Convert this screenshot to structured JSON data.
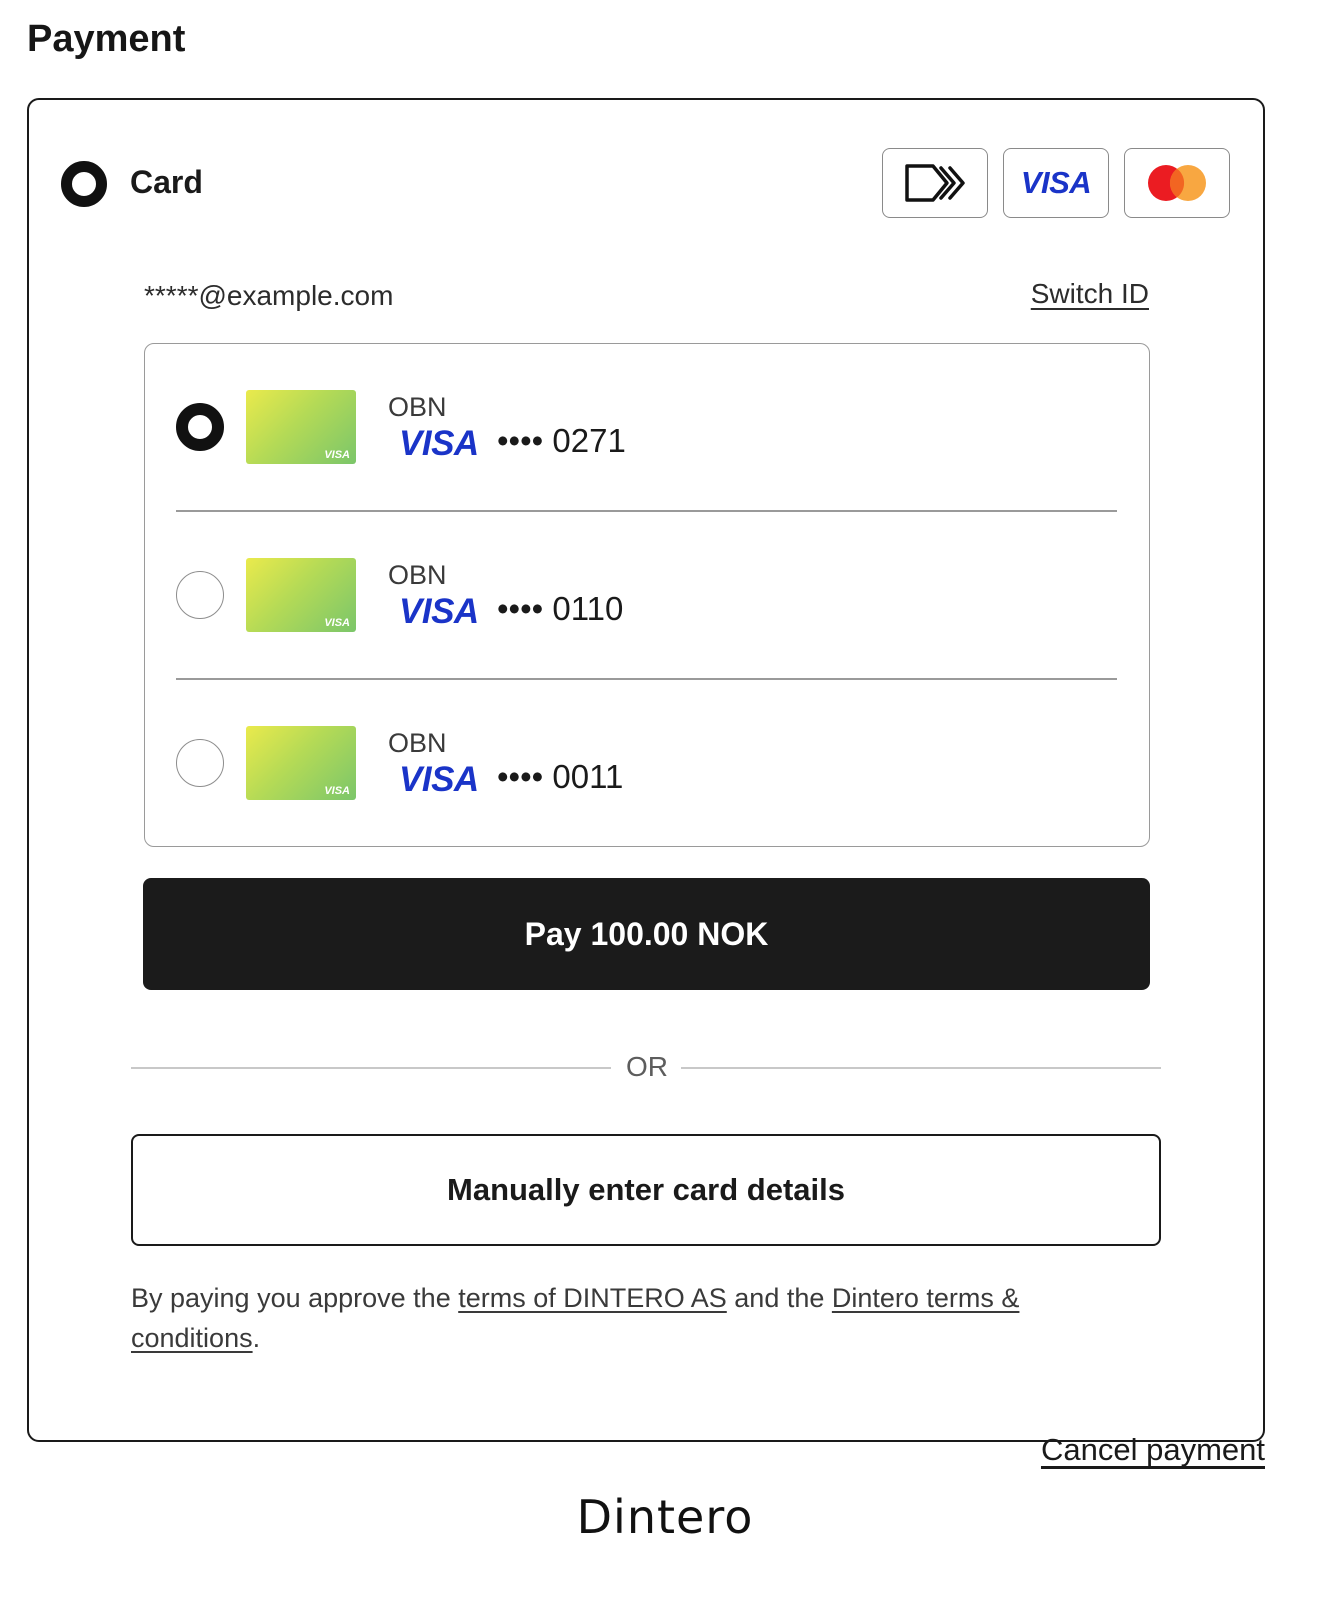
{
  "page": {
    "title": "Payment"
  },
  "method": {
    "label": "Card",
    "brands": [
      {
        "name": "click-to-pay-icon"
      },
      {
        "name": "visa",
        "text": "VISA"
      },
      {
        "name": "mastercard-icon"
      }
    ]
  },
  "identity": {
    "email": "*****@example.com",
    "switch_label": "Switch ID"
  },
  "saved_cards": [
    {
      "issuer": "OBN",
      "brand": "VISA",
      "thumb_brand": "VISA",
      "masked": "•••• 0271",
      "selected": true
    },
    {
      "issuer": "OBN",
      "brand": "VISA",
      "thumb_brand": "VISA",
      "masked": "•••• 0110",
      "selected": false
    },
    {
      "issuer": "OBN",
      "brand": "VISA",
      "thumb_brand": "VISA",
      "masked": "•••• 0011",
      "selected": false
    }
  ],
  "pay_button": {
    "label": "Pay 100.00 NOK"
  },
  "separator": {
    "label": "OR"
  },
  "manual_button": {
    "label": "Manually enter card details"
  },
  "terms": {
    "prefix": "By paying you approve the ",
    "link1": "terms of DINTERO AS",
    "middle": " and the ",
    "link2": "Dintero terms & conditions",
    "suffix": "."
  },
  "footer": {
    "cancel_label": "Cancel payment",
    "logo_text": "Dintero"
  },
  "colors": {
    "visa_blue": "#1a34c8",
    "mastercard_red": "#eb1c22",
    "mastercard_orange": "#f7a031",
    "button_dark": "#1b1b1b"
  }
}
